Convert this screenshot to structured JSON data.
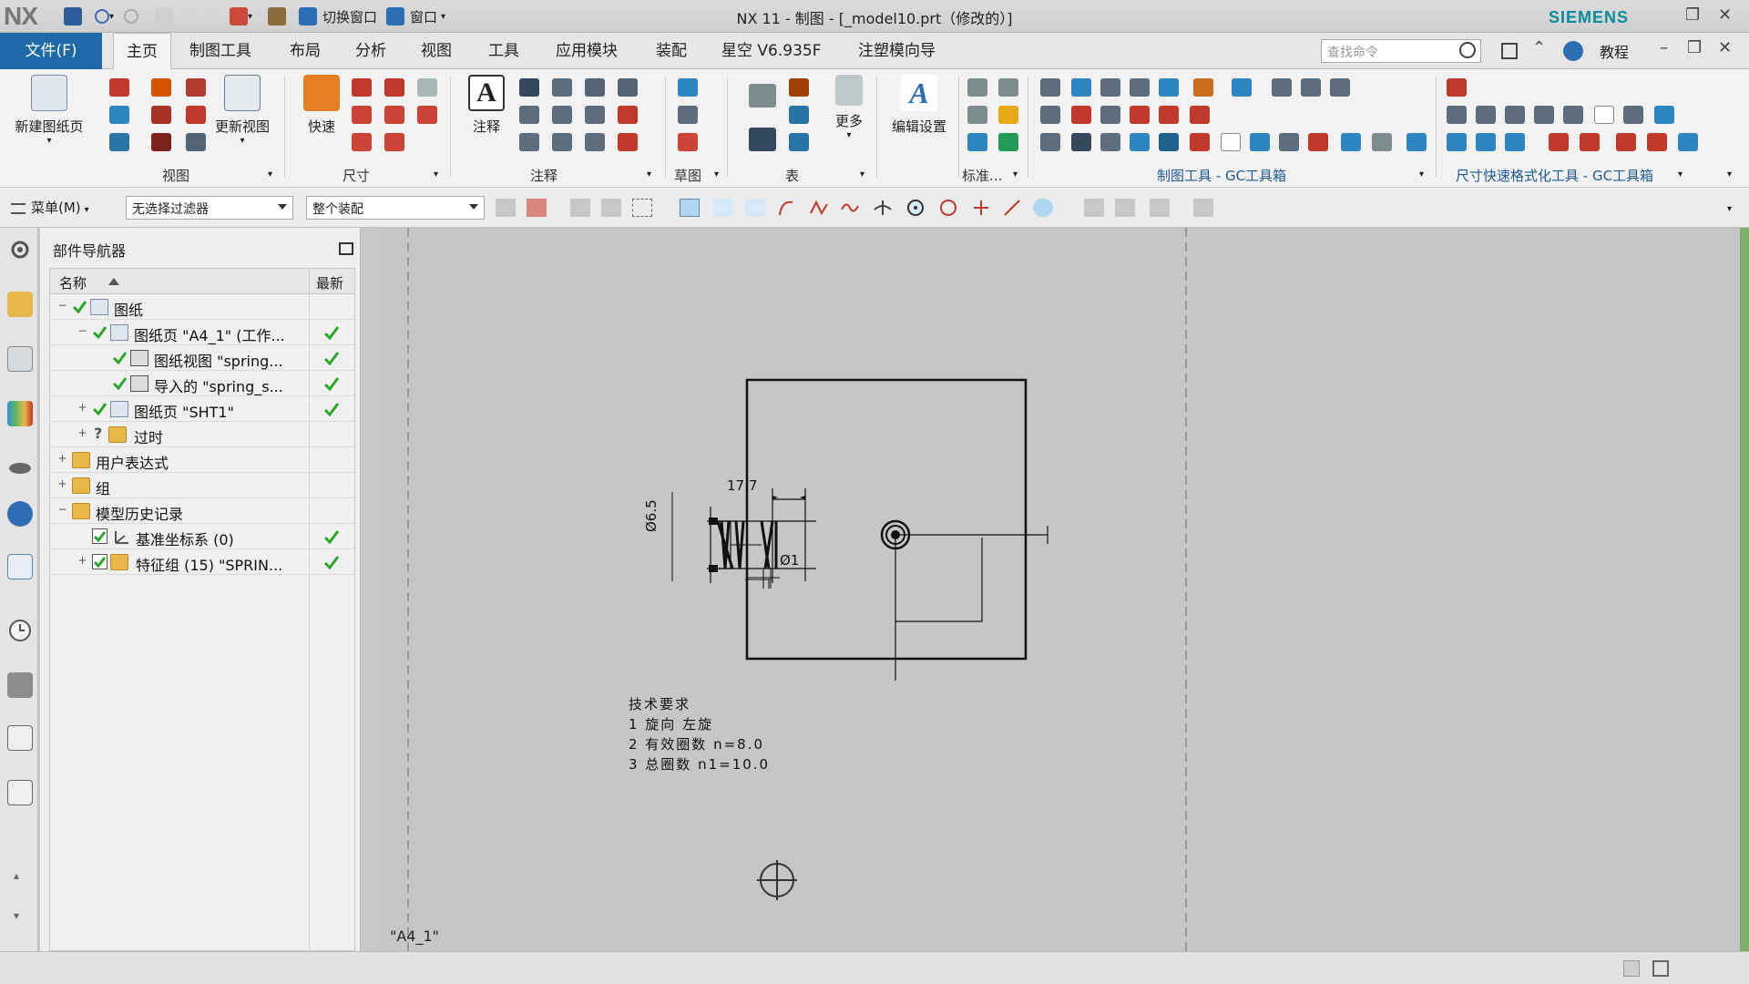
{
  "app": {
    "logo": "NX",
    "title": "NX 11 - 制图 - [_model10.prt（修改的）]",
    "brand": "SIEMENS",
    "quick_access": {
      "switch_window": "切换窗口",
      "window": "窗口"
    }
  },
  "tabs": {
    "file": "文件(F)",
    "items": [
      "主页",
      "制图工具",
      "布局",
      "分析",
      "视图",
      "工具",
      "应用模块",
      "装配",
      "星空 V6.935F",
      "注塑模向导"
    ],
    "active": "主页",
    "search_placeholder": "查找命令",
    "help": "教程"
  },
  "ribbon": {
    "new_sheet": "新建图纸页",
    "update_views": "更新视图",
    "quick": "快速",
    "note": "注释",
    "more": "更多",
    "edit_settings": "编辑设置",
    "groups": {
      "view": "视图",
      "dimension": "尺寸",
      "annotation": "注释",
      "sketch": "草图",
      "table": "表",
      "standard": "标准...",
      "gc_tools": "制图工具 - GC工具箱",
      "gc_dim": "尺寸快速格式化工具 - GC工具箱"
    }
  },
  "cmdbar": {
    "menu": "菜单(M)",
    "filter": "无选择过滤器",
    "scope": "整个装配"
  },
  "navigator": {
    "title": "部件导航器",
    "col_name": "名称",
    "col_latest": "最新",
    "rows": [
      {
        "label": "图纸"
      },
      {
        "label": "图纸页 \"A4_1\" (工作..."
      },
      {
        "label": "图纸视图 \"spring..."
      },
      {
        "label": "导入的 \"spring_s..."
      },
      {
        "label": "图纸页 \"SHT1\""
      },
      {
        "label": "过时"
      },
      {
        "label": "用户表达式"
      },
      {
        "label": "组"
      },
      {
        "label": "模型历史记录"
      },
      {
        "label": "基准坐标系 (0)"
      },
      {
        "label": "特征组 (15) \"SPRIN..."
      }
    ]
  },
  "drawing": {
    "sheet_name": "\"A4_1\"",
    "dim_length": "17.7",
    "dim_diameter": "Ø6.5",
    "dim_wire": "Ø1",
    "tech_title": "技术要求",
    "tech_lines": [
      "1  旋向  左旋",
      "2  有效圈数  n=8.0",
      "3  总圈数  n1=10.0"
    ]
  },
  "colors": {
    "file_tab": "#1e6aa8",
    "check_green": "#2aa52a",
    "siemens": "#0a8c9c"
  }
}
